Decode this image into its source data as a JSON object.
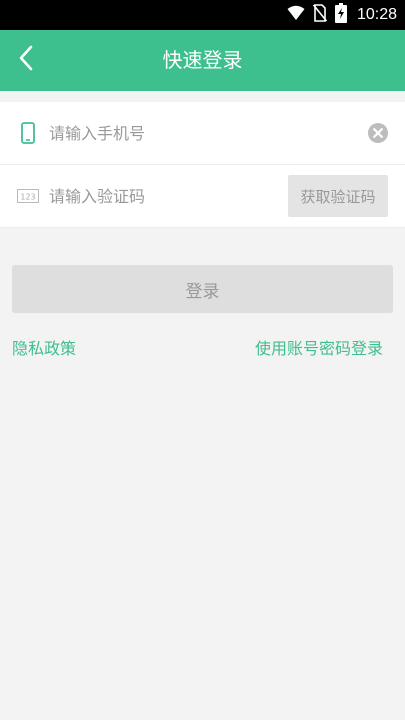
{
  "status_bar": {
    "time": "10:28",
    "icons": [
      "wifi-icon",
      "no-sim-icon",
      "battery-charging-icon"
    ]
  },
  "app_bar": {
    "title": "快速登录",
    "back_icon": "chevron-left-icon"
  },
  "form": {
    "phone": {
      "icon": "phone-icon",
      "placeholder": "请输入手机号",
      "value": "",
      "clear_icon": "clear-circle-icon"
    },
    "code": {
      "icon": "numeric-keypad-icon",
      "icon_text": "123",
      "placeholder": "请输入验证码",
      "value": "",
      "get_code_label": "获取验证码"
    }
  },
  "login_button": {
    "label": "登录"
  },
  "links": {
    "privacy": "隐私政策",
    "password_login": "使用账号密码登录"
  },
  "colors": {
    "accent": "#3ebf8e",
    "background": "#f3f3f3",
    "disabled_button": "#dedede"
  }
}
